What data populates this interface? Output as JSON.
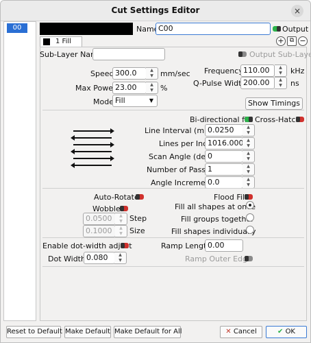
{
  "window": {
    "title": "Cut Settings Editor",
    "close_glyph": "×"
  },
  "layers": [
    {
      "label": "00"
    }
  ],
  "layer": {
    "name_label": "Name",
    "name_value": "C00",
    "output_label": "Output",
    "color": "#000000"
  },
  "tab": {
    "label": "1 Fill"
  },
  "sublayer": {
    "name_label": "Sub-Layer Name",
    "name_value": "",
    "output_label": "Output Sub-Layer"
  },
  "params": {
    "speed": {
      "label": "Speed",
      "value": "300.0",
      "unit": "mm/sec"
    },
    "max_power": {
      "label": "Max Power",
      "value": "23.00",
      "unit": "%"
    },
    "mode": {
      "label": "Mode",
      "value": "Fill"
    },
    "frequency": {
      "label": "Frequency",
      "value": "110.00",
      "unit": "kHz"
    },
    "qpulse": {
      "label": "Q-Pulse Width",
      "value": "200.00",
      "unit": "ns"
    },
    "show_timings": "Show Timings"
  },
  "fill": {
    "bidir_label": "Bi-directional fill",
    "crosshatch_label": "Cross-Hatch",
    "line_interval": {
      "label": "Line Interval (mm)",
      "value": "0.0250"
    },
    "lpi": {
      "label": "Lines per Inch",
      "value": "1016.000"
    },
    "scan_angle": {
      "label": "Scan Angle (deg)",
      "value": "0"
    },
    "passes": {
      "label": "Number of Passes",
      "value": "1"
    },
    "angle_increment": {
      "label": "Angle Increment",
      "value": "0.0"
    }
  },
  "options": {
    "auto_rotate": "Auto-Rotate",
    "wobble": "Wobble",
    "step": {
      "label": "Step",
      "value": "0.0500"
    },
    "size": {
      "label": "Size",
      "value": "0.1000"
    },
    "flood_fill": "Flood Fill",
    "fill_all": "Fill all shapes at once",
    "fill_groups": "Fill groups together",
    "fill_individually": "Fill shapes individually"
  },
  "dot": {
    "enable_label": "Enable dot-width adjust",
    "width_label": "Dot Width:",
    "width_value": "0.080",
    "ramp_length_label": "Ramp Length",
    "ramp_length_value": "0.00",
    "ramp_outer_label": "Ramp Outer Edge"
  },
  "footer": {
    "reset": "Reset to Default",
    "make_default": "Make Default",
    "make_default_all": "Make Default for All",
    "cancel": "Cancel",
    "ok": "OK"
  },
  "icons": {
    "add": "plus-circle-icon",
    "copy": "copy-icon",
    "remove": "minus-circle-icon",
    "cancel": "x-icon",
    "ok": "check-icon"
  },
  "colors": {
    "selection": "#2a6fd4",
    "toggle_on": "#2bb34a",
    "toggle_off": "#d0312d"
  }
}
